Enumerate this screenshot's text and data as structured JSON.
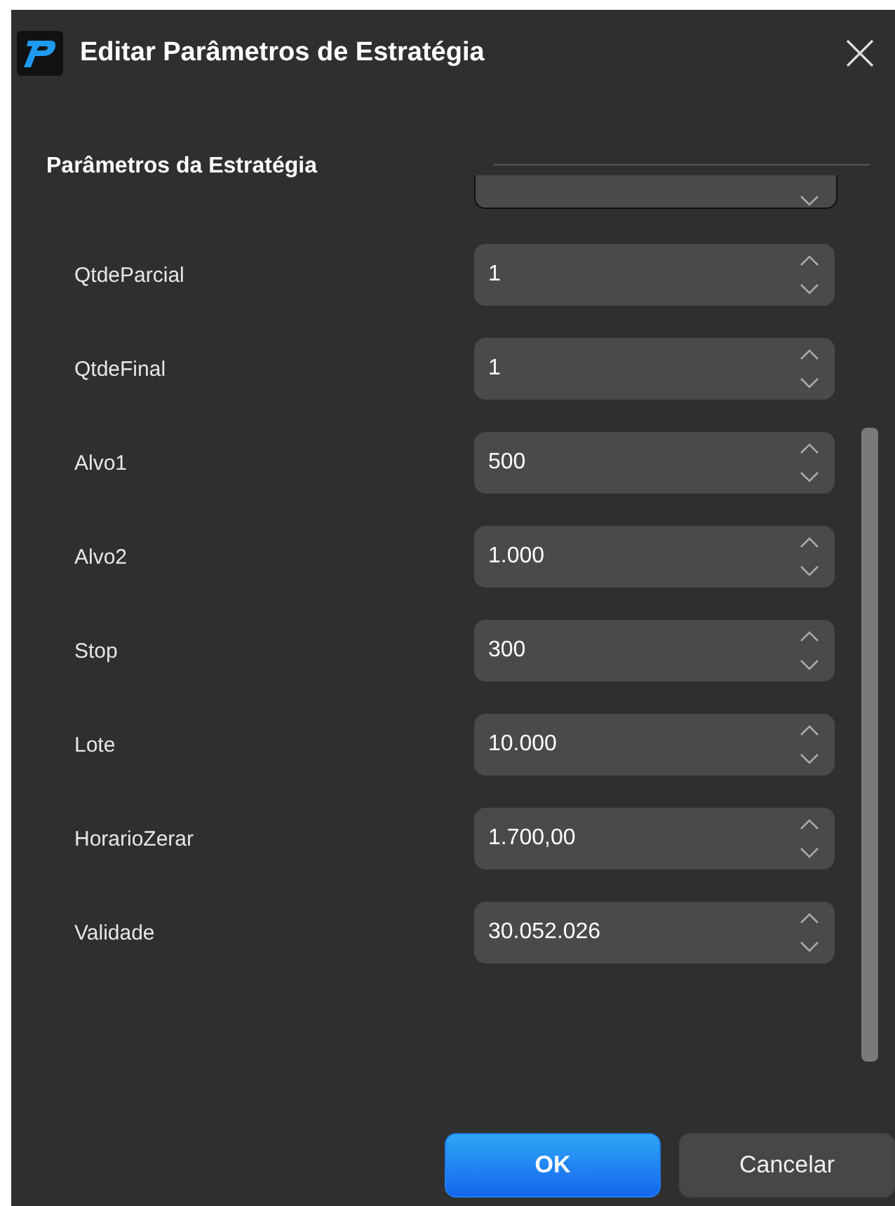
{
  "window": {
    "title": "Editar Parâmetros de Estratégia"
  },
  "group": {
    "title": "Parâmetros da Estratégia"
  },
  "params": [
    {
      "label": "QtdeParcial",
      "value": "1"
    },
    {
      "label": "QtdeFinal",
      "value": "1"
    },
    {
      "label": "Alvo1",
      "value": "500"
    },
    {
      "label": "Alvo2",
      "value": "1.000"
    },
    {
      "label": "Stop",
      "value": "300"
    },
    {
      "label": "Lote",
      "value": "10.000"
    },
    {
      "label": "HorarioZerar",
      "value": "1.700,00"
    },
    {
      "label": "Validade",
      "value": "30.052.026"
    }
  ],
  "buttons": [
    {
      "label": "OK",
      "kind": "primary"
    },
    {
      "label": "Cancelar",
      "kind": "secondary"
    }
  ]
}
